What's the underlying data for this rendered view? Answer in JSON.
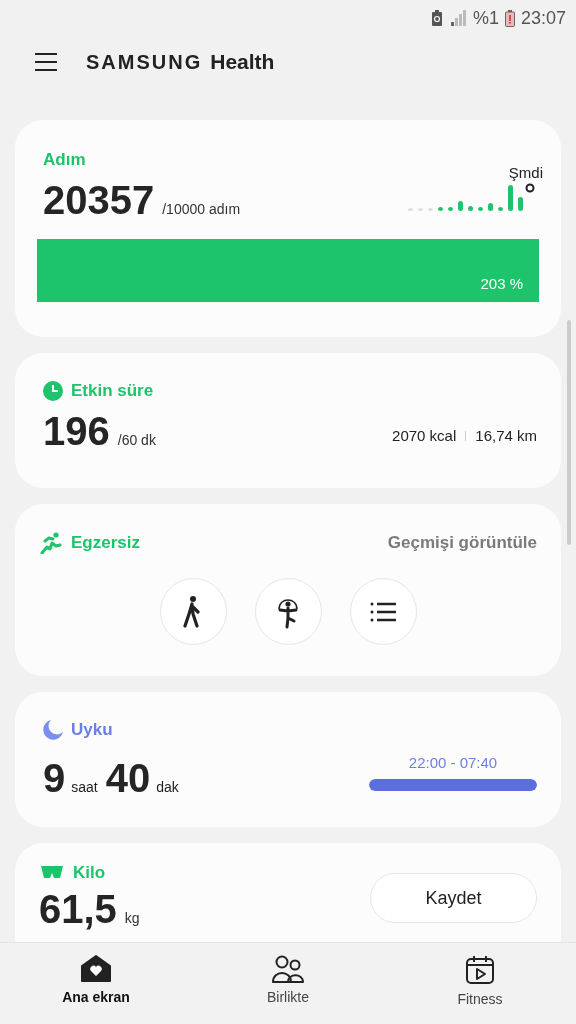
{
  "status_bar": {
    "battery_text": "%1",
    "time": "23:07"
  },
  "app_bar": {
    "brand": "SAMSUNG",
    "title": "Health"
  },
  "steps": {
    "title": "Adım",
    "value": "20357",
    "goal": "/10000 adım",
    "now_label": "Şmdi",
    "level": 1,
    "percent": "203 %"
  },
  "active_time": {
    "title": "Etkin süre",
    "value": "196",
    "goal": "/60 dk",
    "calories": "2070 kcal",
    "distance": "16,74 km"
  },
  "exercise": {
    "title": "Egzersiz",
    "link": "Geçmişi görüntüle",
    "shortcuts": [
      {
        "kind": "walk"
      },
      {
        "kind": "rope"
      },
      {
        "kind": "list"
      }
    ]
  },
  "sleep": {
    "title": "Uyku",
    "hours": "9",
    "hours_unit": "saat",
    "minutes": "40",
    "minutes_unit": "dak",
    "range": "22:00 - 07:40",
    "level": 1
  },
  "weight": {
    "title": "Kilo",
    "value": "61,5",
    "unit": "kg",
    "button": "Kaydet"
  },
  "nav": [
    {
      "label": "Ana ekran",
      "kind": "home",
      "selected": true
    },
    {
      "label": "Birlikte",
      "kind": "people",
      "selected": false
    },
    {
      "label": "Fitness",
      "kind": "fitness",
      "selected": false
    }
  ]
}
